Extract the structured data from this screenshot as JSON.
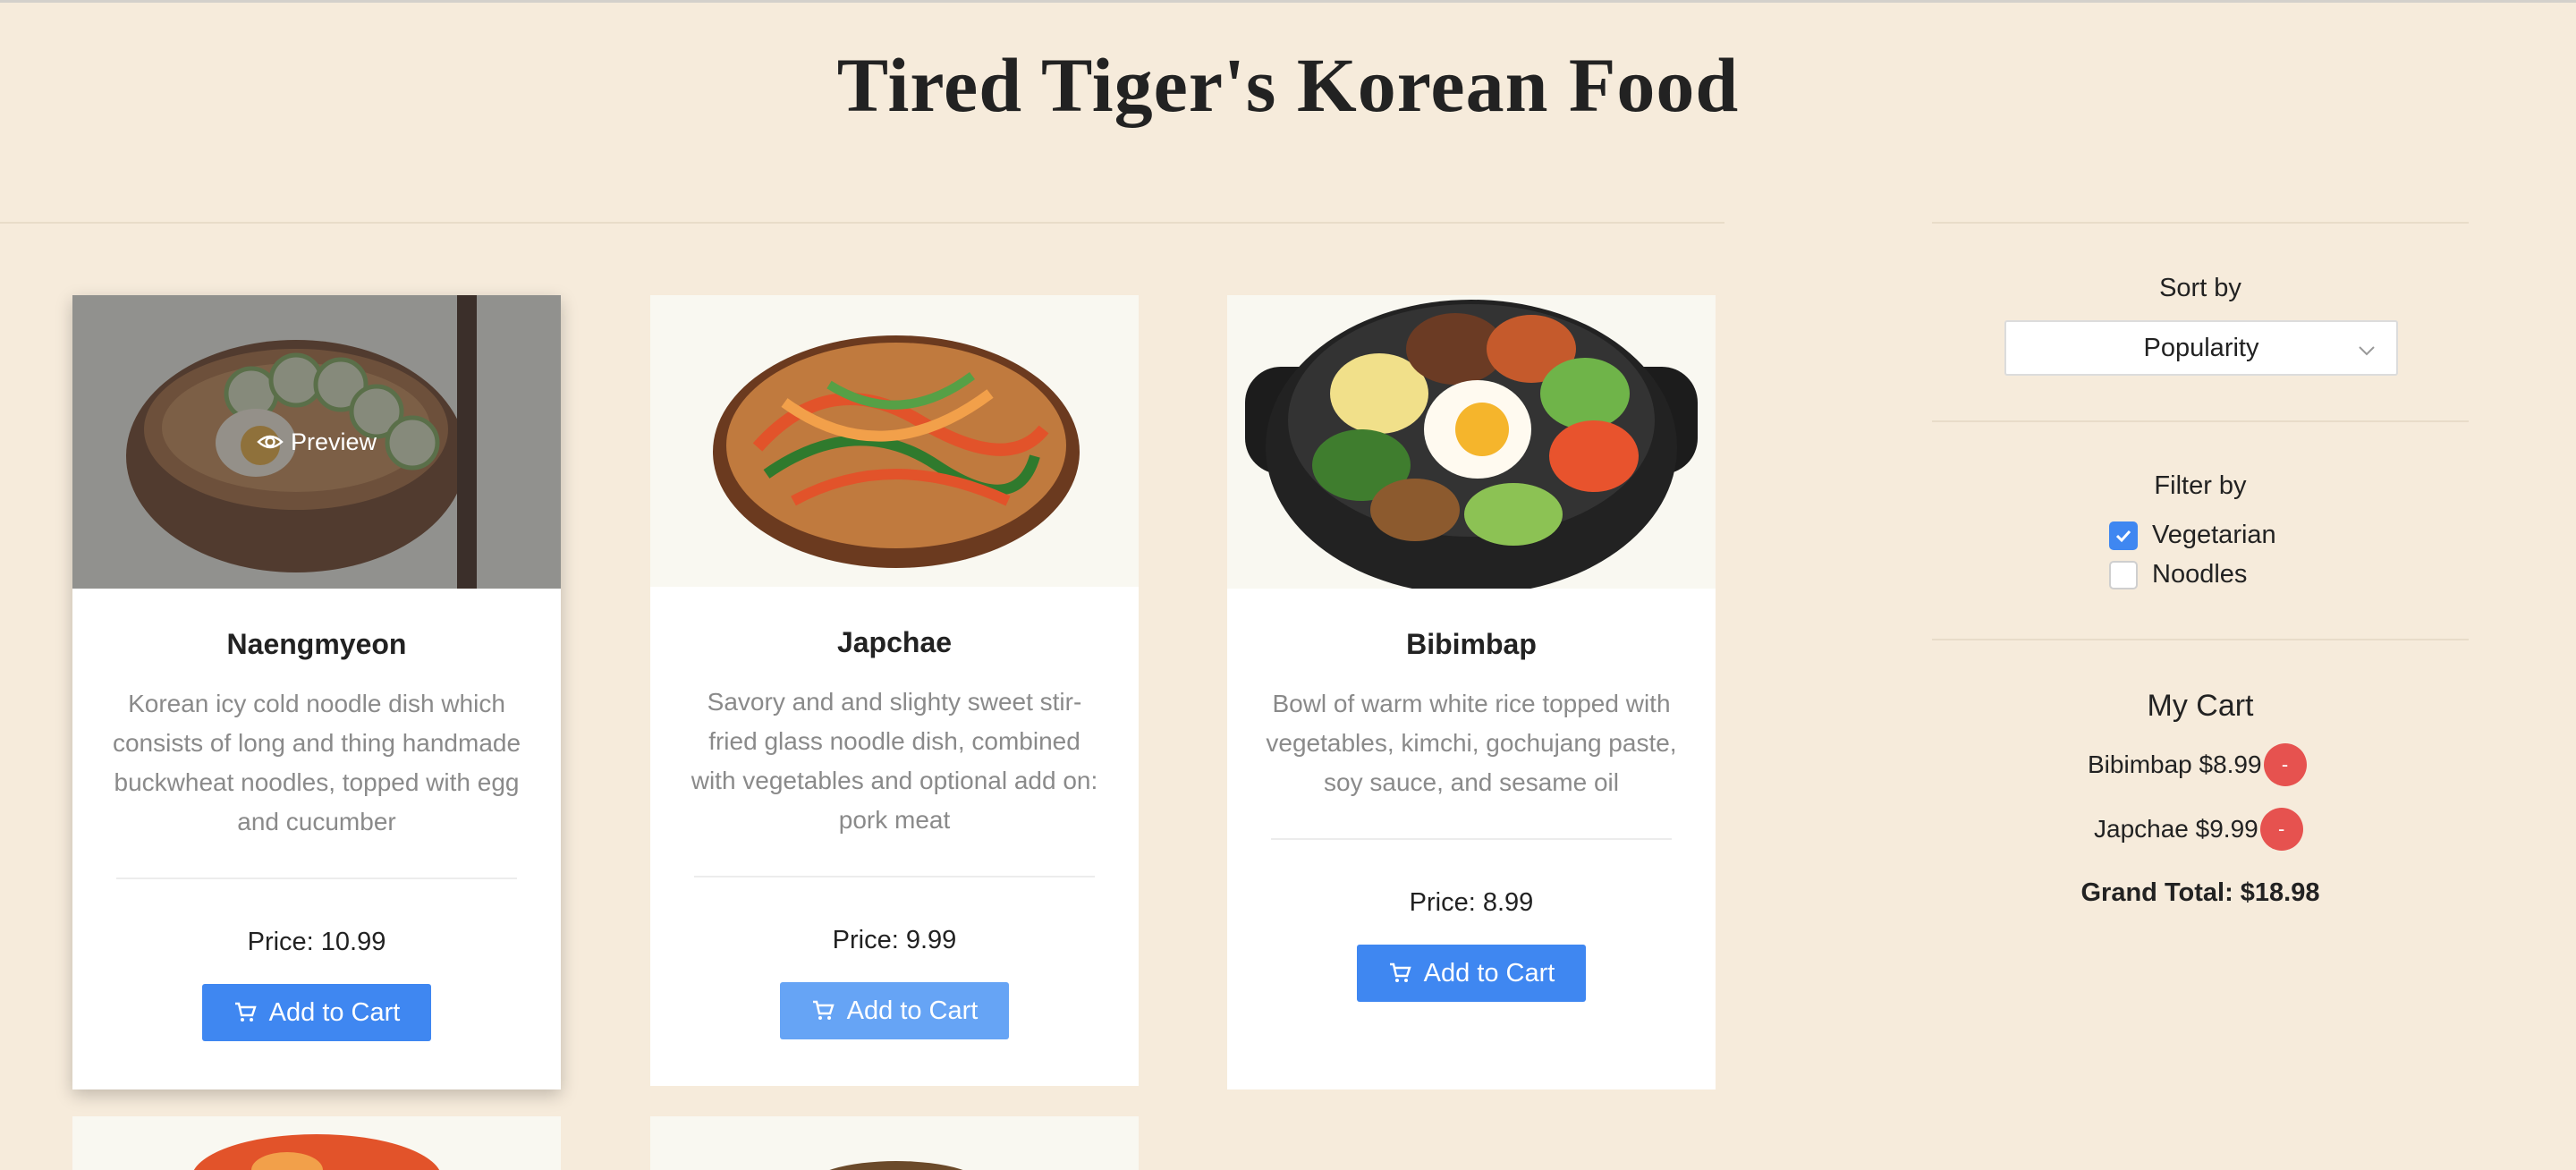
{
  "header": {
    "title": "Tired Tiger's Korean Food"
  },
  "products": [
    {
      "name": "Naengmyeon",
      "description": "Korean icy cold noodle dish which consists of long and thing handmade buckwheat noodles, topped with egg and cucumber",
      "price": "Price: 10.99",
      "button_label": "Add to Cart",
      "preview_label": "Preview"
    },
    {
      "name": "Japchae",
      "description": "Savory and and slighty sweet stir-fried glass noodle dish, combined with vegetables and optional add on: pork meat",
      "price": "Price: 9.99",
      "button_label": "Add to Cart"
    },
    {
      "name": "Bibimbap",
      "description": "Bowl of warm white rice topped with vegetables, kimchi, gochujang paste, soy sauce, and sesame oil",
      "price": "Price: 8.99",
      "button_label": "Add to Cart"
    }
  ],
  "sidebar": {
    "sort": {
      "label": "Sort by",
      "selected": "Popularity"
    },
    "filter": {
      "label": "Filter by",
      "options": [
        {
          "label": "Vegetarian",
          "checked": true
        },
        {
          "label": "Noodles",
          "checked": false
        }
      ]
    },
    "cart": {
      "title": "My Cart",
      "items": [
        {
          "label": "Bibimbap $8.99",
          "remove": "-"
        },
        {
          "label": "Japchae $9.99",
          "remove": "-"
        }
      ],
      "grand_total": "Grand Total: $18.98"
    }
  },
  "colors": {
    "background": "#f6ebdb",
    "primary_button": "#3f87f1",
    "remove_button": "#e6524f",
    "checkbox_checked": "#3f87f1"
  }
}
